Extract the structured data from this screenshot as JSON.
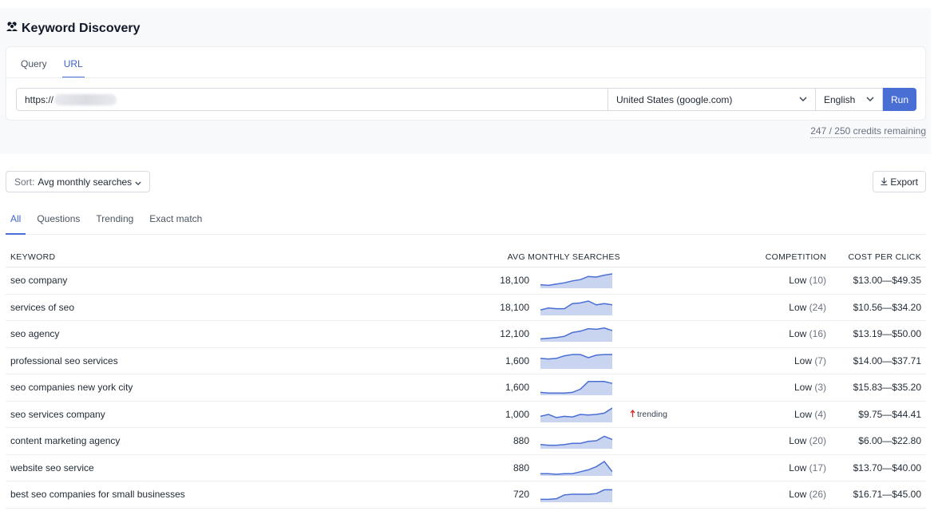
{
  "app": {
    "title": "Keyword Discovery"
  },
  "mode_tabs": [
    {
      "label": "Query"
    },
    {
      "label": "URL",
      "active": true
    }
  ],
  "search": {
    "url_value": "https://",
    "country": "United States (google.com)",
    "language": "English",
    "run_label": "Run"
  },
  "credits": "247 / 250 credits remaining",
  "sort": {
    "prefix": "Sort:",
    "value": "Avg monthly searches"
  },
  "export_label": "Export",
  "filter_tabs": [
    {
      "label": "All",
      "active": true
    },
    {
      "label": "Questions"
    },
    {
      "label": "Trending"
    },
    {
      "label": "Exact match"
    }
  ],
  "table": {
    "headers": {
      "keyword": "KEYWORD",
      "searches": "AVG MONTHLY SEARCHES",
      "competition": "COMPETITION",
      "cpc": "COST PER CLICK"
    },
    "rows": [
      {
        "keyword": "seo company",
        "searches": "18,100",
        "trend": [
          0.15,
          0.1,
          0.2,
          0.3,
          0.45,
          0.55,
          0.8,
          0.75,
          0.9,
          1.0
        ],
        "trending": "",
        "competition": "Low",
        "score": "(10)",
        "cpc": "$13.00—$49.35"
      },
      {
        "keyword": "services of seo",
        "searches": "18,100",
        "trend": [
          0.3,
          0.45,
          0.4,
          0.4,
          0.8,
          0.85,
          1.0,
          0.7,
          0.8,
          0.7
        ],
        "trending": "",
        "competition": "Low",
        "score": "(24)",
        "cpc": "$10.56—$34.20"
      },
      {
        "keyword": "seo agency",
        "searches": "12,100",
        "trend": [
          0.1,
          0.15,
          0.2,
          0.3,
          0.6,
          0.7,
          0.9,
          0.85,
          0.95,
          0.75
        ],
        "trending": "",
        "competition": "Low",
        "score": "(16)",
        "cpc": "$13.19—$50.00"
      },
      {
        "keyword": "professional seo services",
        "searches": "1,600",
        "trend": [
          0.7,
          0.65,
          0.7,
          0.9,
          1.0,
          1.0,
          0.75,
          0.95,
          1.0,
          1.0
        ],
        "trending": "",
        "competition": "Low",
        "score": "(7)",
        "cpc": "$14.00—$37.71"
      },
      {
        "keyword": "seo companies new york city",
        "searches": "1,600",
        "trend": [
          0.1,
          0.05,
          0.05,
          0.05,
          0.1,
          0.35,
          0.95,
          0.95,
          0.95,
          0.8
        ],
        "trending": "",
        "competition": "Low",
        "score": "(3)",
        "cpc": "$15.83—$35.20"
      },
      {
        "keyword": "seo services company",
        "searches": "1,000",
        "trend": [
          0.35,
          0.5,
          0.25,
          0.35,
          0.3,
          0.5,
          0.45,
          0.5,
          0.6,
          1.0
        ],
        "trending": "trending",
        "competition": "Low",
        "score": "(4)",
        "cpc": "$9.75—$44.41"
      },
      {
        "keyword": "content marketing agency",
        "searches": "880",
        "trend": [
          0.2,
          0.15,
          0.15,
          0.2,
          0.3,
          0.3,
          0.45,
          0.5,
          0.85,
          0.6
        ],
        "trending": "",
        "competition": "Low",
        "score": "(20)",
        "cpc": "$6.00—$22.80"
      },
      {
        "keyword": "website seo service",
        "searches": "880",
        "trend": [
          0.05,
          0.05,
          0.0,
          0.05,
          0.05,
          0.2,
          0.35,
          0.6,
          1.0,
          0.2
        ],
        "trending": "",
        "competition": "Low",
        "score": "(17)",
        "cpc": "$13.70—$40.00"
      },
      {
        "keyword": "best seo companies for small businesses",
        "searches": "720",
        "trend": [
          0.1,
          0.1,
          0.15,
          0.45,
          0.5,
          0.5,
          0.5,
          0.55,
          0.85,
          0.85
        ],
        "trending": "",
        "competition": "Low",
        "score": "(26)",
        "cpc": "$16.71—$45.00"
      }
    ]
  },
  "colors": {
    "accent": "#4a6fd4",
    "spark_fill": "#c9d4f1",
    "trend_arrow": "#dc2626"
  }
}
